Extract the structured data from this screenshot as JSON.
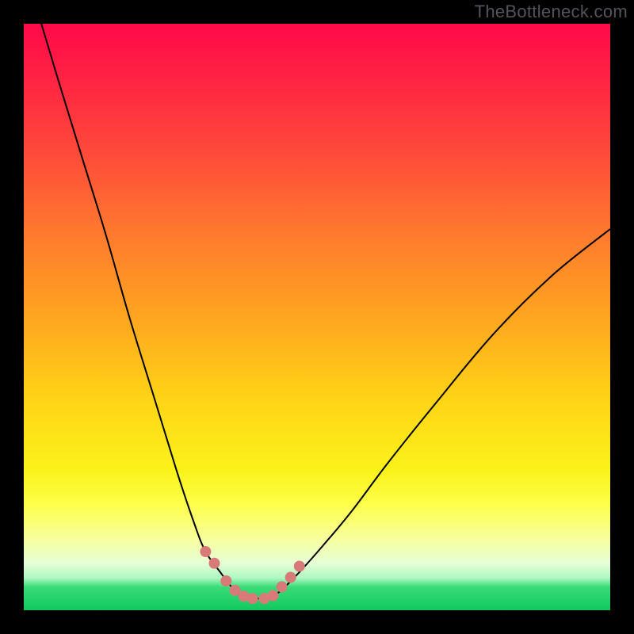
{
  "watermark": "TheBottleneck.com",
  "colors": {
    "frame": "#000000",
    "gradient_top": "#ff0a49",
    "gradient_mid": "#ffd416",
    "gradient_bottom": "#10c95e",
    "curve": "#000000",
    "marker": "#d87a78"
  },
  "chart_data": {
    "type": "line",
    "title": "",
    "xlabel": "",
    "ylabel": "",
    "xlim": [
      0,
      100
    ],
    "ylim": [
      0,
      100
    ],
    "curves": [
      {
        "name": "left",
        "x": [
          3,
          6,
          10,
          14,
          18,
          22,
          26,
          29,
          31,
          33.5,
          35,
          36.5,
          38
        ],
        "y": [
          100,
          90,
          77,
          64,
          50,
          37,
          24,
          15,
          10,
          6.5,
          4.5,
          2.8,
          2.0
        ]
      },
      {
        "name": "right",
        "x": [
          42,
          44,
          47,
          51,
          56,
          62,
          70,
          80,
          90,
          100
        ],
        "y": [
          2.0,
          3.5,
          6.5,
          11,
          17,
          25,
          35,
          47,
          57,
          65
        ]
      }
    ],
    "flat_segment": {
      "x": [
        38,
        42
      ],
      "y": 2.0
    },
    "markers": [
      {
        "x": 31.0,
        "y": 10.0
      },
      {
        "x": 32.5,
        "y": 8.0
      },
      {
        "x": 34.5,
        "y": 5.0
      },
      {
        "x": 36.0,
        "y": 3.4
      },
      {
        "x": 37.5,
        "y": 2.4
      },
      {
        "x": 39.0,
        "y": 2.0
      },
      {
        "x": 41.0,
        "y": 2.0
      },
      {
        "x": 42.5,
        "y": 2.5
      },
      {
        "x": 44.0,
        "y": 4.0
      },
      {
        "x": 45.5,
        "y": 5.6
      },
      {
        "x": 47.0,
        "y": 7.5
      }
    ],
    "marker_radius_px": 7
  }
}
